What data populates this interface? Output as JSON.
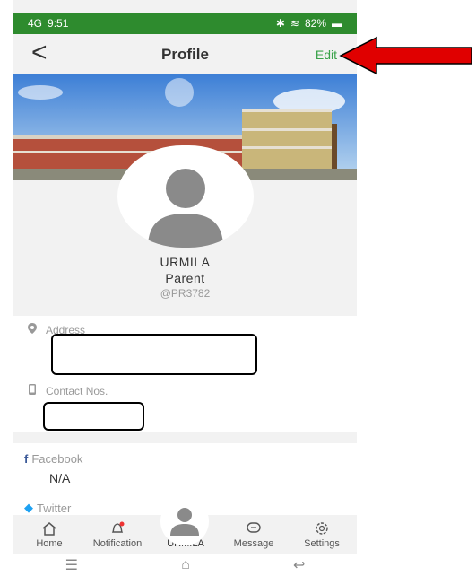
{
  "status_bar": {
    "network": "4G",
    "time": "9:51",
    "battery": "82%"
  },
  "header": {
    "title": "Profile",
    "edit_label": "Edit",
    "back_icon": "chevron-left-icon"
  },
  "profile": {
    "name": "URMILA",
    "role": "Parent",
    "handle": "@PR3782"
  },
  "info": {
    "address_label": "Address",
    "contact_label": "Contact Nos."
  },
  "social": {
    "facebook_label": "Facebook",
    "facebook_value": "N/A",
    "twitter_label": "Twitter"
  },
  "tabs": [
    {
      "label": "Home",
      "icon": "home-icon"
    },
    {
      "label": "Notification",
      "icon": "bell-icon"
    },
    {
      "label": "URMILA",
      "icon": "avatar-icon"
    },
    {
      "label": "Message",
      "icon": "chat-icon"
    },
    {
      "label": "Settings",
      "icon": "gear-icon"
    }
  ],
  "colors": {
    "status_bar": "#2e8b2e",
    "accent": "#3aa34a",
    "arrow": "#e00000"
  }
}
